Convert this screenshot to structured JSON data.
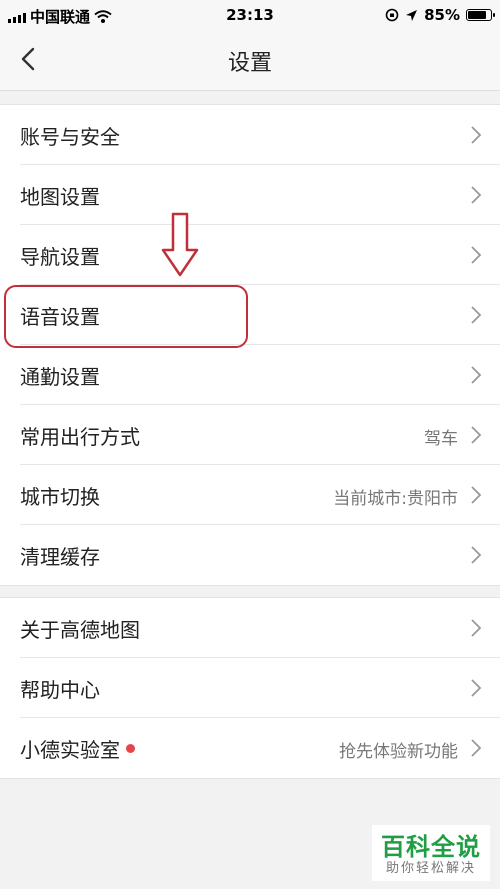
{
  "status_bar": {
    "carrier": "中国联通",
    "time": "23:13",
    "battery": "85%",
    "battery_level": 0.85
  },
  "nav": {
    "title": "设置",
    "back_icon": "chevron-left-icon"
  },
  "groups": [
    {
      "items": [
        {
          "label": "账号与安全",
          "value": ""
        },
        {
          "label": "地图设置",
          "value": ""
        },
        {
          "label": "导航设置",
          "value": ""
        },
        {
          "label": "语音设置",
          "value": ""
        },
        {
          "label": "通勤设置",
          "value": ""
        },
        {
          "label": "常用出行方式",
          "value": "驾车"
        },
        {
          "label": "城市切换",
          "value": "当前城市:贵阳市"
        },
        {
          "label": "清理缓存",
          "value": ""
        }
      ]
    },
    {
      "items": [
        {
          "label": "关于高德地图",
          "value": ""
        },
        {
          "label": "帮助中心",
          "value": ""
        },
        {
          "label": "小德实验室",
          "value": "抢先体验新功能",
          "has_dot": true
        }
      ]
    }
  ],
  "annotation": {
    "highlight_color": "#c0303a",
    "arrow_color": "#c0303a"
  },
  "watermark": {
    "title": "百科全说",
    "subtitle": "助你轻松解决"
  }
}
